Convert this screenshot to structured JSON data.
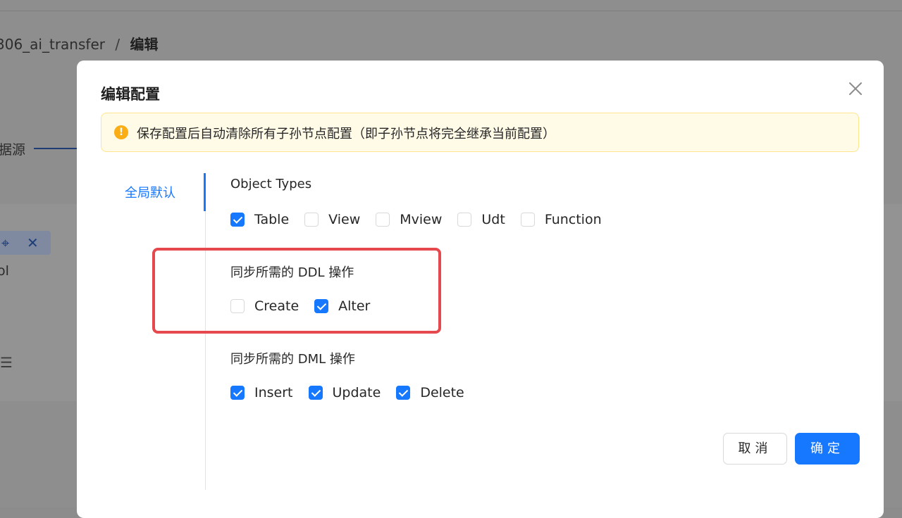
{
  "background": {
    "breadcrumb": {
      "parent": "306_ai_transfer",
      "separator": "/",
      "current": "编辑"
    },
    "tab_label": "据源",
    "text_fragment": "ol",
    "menu_glyph": "☰"
  },
  "modal": {
    "title": "编辑配置",
    "alert": {
      "icon": "exclamation-icon",
      "text": "保存配置后自动清除所有子孙节点配置（即子孙节点将完全继承当前配置）"
    },
    "left_tabs": [
      {
        "label": "全局默认",
        "active": true
      }
    ],
    "object_types": {
      "title": "Object Types",
      "options": [
        {
          "label": "Table",
          "checked": true
        },
        {
          "label": "View",
          "checked": false
        },
        {
          "label": "Mview",
          "checked": false
        },
        {
          "label": "Udt",
          "checked": false
        },
        {
          "label": "Function",
          "checked": false
        }
      ]
    },
    "ddl": {
      "title": "同步所需的 DDL 操作",
      "options": [
        {
          "label": "Create",
          "checked": false
        },
        {
          "label": "Alter",
          "checked": true
        }
      ]
    },
    "dml": {
      "title": "同步所需的 DML 操作",
      "options": [
        {
          "label": "Insert",
          "checked": true
        },
        {
          "label": "Update",
          "checked": true
        },
        {
          "label": "Delete",
          "checked": true
        }
      ]
    },
    "buttons": {
      "cancel": "取消",
      "ok": "确定"
    }
  },
  "colors": {
    "primary": "#1677ff",
    "alert_bg": "#fffbe6",
    "alert_border": "#ffe58f",
    "warning": "#faad14",
    "highlight": "#e5484d",
    "overlay": "#8e8e8e"
  }
}
